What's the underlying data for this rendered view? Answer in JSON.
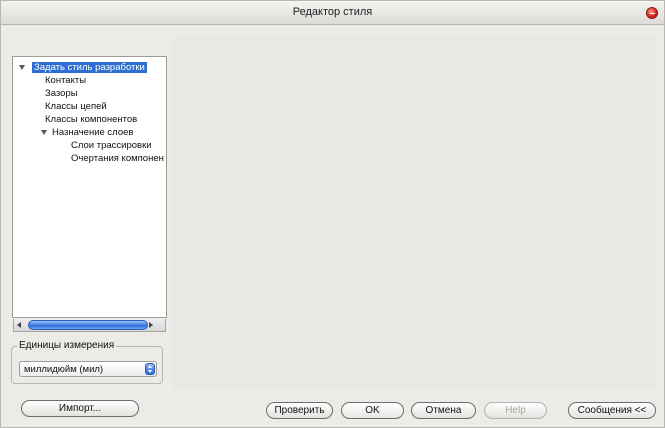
{
  "window": {
    "title": "Редактор стиля"
  },
  "tree": {
    "items": [
      {
        "label": "Задать стиль разработки",
        "selected": true
      },
      {
        "label": "Контакты"
      },
      {
        "label": "Зазоры"
      },
      {
        "label": "Классы цепей"
      },
      {
        "label": "Классы компонентов"
      },
      {
        "label": "Назначение слоев"
      },
      {
        "label": "Слои трассировки"
      },
      {
        "label": "Очертания компонен"
      }
    ]
  },
  "units": {
    "legend": "Единицы измерения",
    "selected": "миллидюйм (мил)"
  },
  "buttons": {
    "import": "Импорт...",
    "verify": "Проверить",
    "ok": "OK",
    "cancel": "Отмена",
    "help": "Help",
    "messages": "Сообщения <<"
  }
}
